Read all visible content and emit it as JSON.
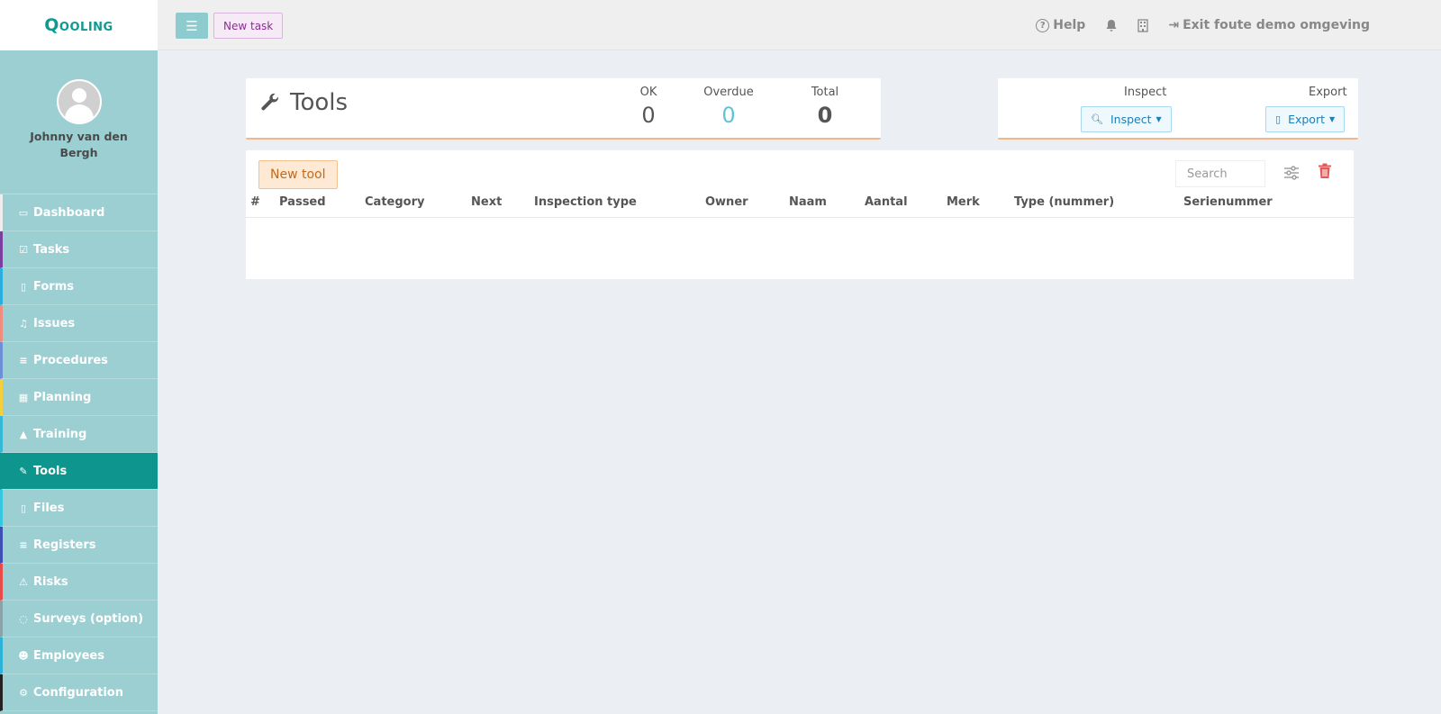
{
  "app": {
    "logo_text": "Qooling"
  },
  "user": {
    "name": "Johnny van den Bergh"
  },
  "sidebar": {
    "items": [
      {
        "label": "Dashboard",
        "icon": "monitor-icon",
        "glyph": "▭",
        "accent": "#eeeeee"
      },
      {
        "label": "Tasks",
        "icon": "check-square-icon",
        "glyph": "☑",
        "accent": "#7b3fa0"
      },
      {
        "label": "Forms",
        "icon": "file-icon",
        "glyph": "▯",
        "accent": "#2aaede"
      },
      {
        "label": "Issues",
        "icon": "bell-icon",
        "glyph": "♫",
        "accent": "#f08c7e"
      },
      {
        "label": "Procedures",
        "icon": "list-icon",
        "glyph": "≡",
        "accent": "#6c8fd6"
      },
      {
        "label": "Planning",
        "icon": "calendar-icon",
        "glyph": "▦",
        "accent": "#f4d03f"
      },
      {
        "label": "Training",
        "icon": "graduation-cap-icon",
        "glyph": "▲",
        "accent": "#35b7d6"
      },
      {
        "label": "Tools",
        "icon": "wrench-icon",
        "glyph": "✎",
        "accent": "#0e968e",
        "active": true
      },
      {
        "label": "Files",
        "icon": "file-pdf-icon",
        "glyph": "▯",
        "accent": "#34c7de"
      },
      {
        "label": "Registers",
        "icon": "bars-icon",
        "glyph": "≡",
        "accent": "#3e4fb8"
      },
      {
        "label": "Risks",
        "icon": "warning-icon",
        "glyph": "⚠",
        "accent": "#e84a4a"
      },
      {
        "label": "Surveys (option)",
        "icon": "comment-icon",
        "glyph": "◌",
        "accent": "#8aa3a8"
      },
      {
        "label": "Employees",
        "icon": "users-icon",
        "glyph": "☻",
        "accent": "#2ab3d6"
      },
      {
        "label": "Configuration",
        "icon": "gear-icon",
        "glyph": "⚙",
        "accent": "#222222"
      }
    ]
  },
  "topbar": {
    "new_task": "New task",
    "help": "Help",
    "exit": "Exit foute demo omgeving"
  },
  "summary": {
    "title": "Tools",
    "ok_label": "OK",
    "ok_value": "0",
    "overdue_label": "Overdue",
    "overdue_value": "0",
    "total_label": "Total",
    "total_value": "0"
  },
  "actions": {
    "inspect_label": "Inspect",
    "inspect_button": "Inspect",
    "export_label": "Export",
    "export_button": "Export"
  },
  "table": {
    "new_tool": "New tool",
    "search_placeholder": "Search",
    "columns": [
      "#",
      "Passed",
      "Category",
      "Next",
      "Inspection type",
      "Owner",
      "Naam",
      "Aantal",
      "Merk",
      "Type (nummer)",
      "Serienummer"
    ],
    "rows": []
  },
  "colors": {
    "brand": "#0e9a92",
    "sidebar": "#9ccfd2",
    "active": "#0e968e",
    "card_accent": "#f1b78a"
  }
}
